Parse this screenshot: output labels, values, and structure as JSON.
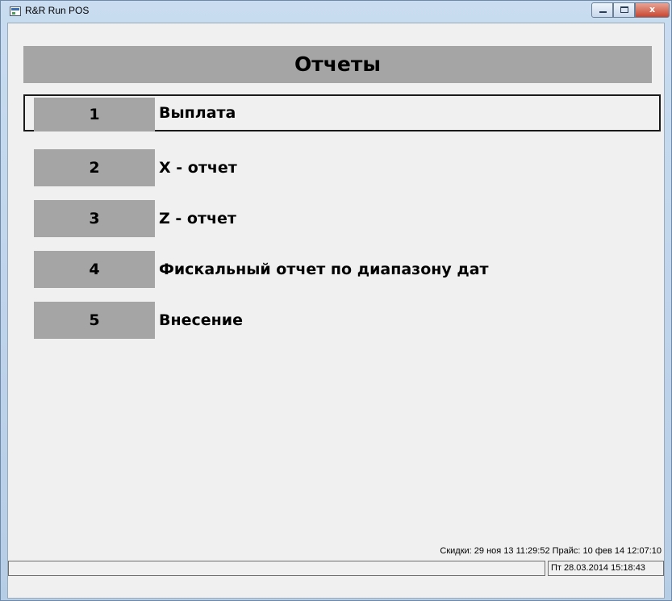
{
  "window": {
    "title": "R&R Run POS",
    "minimize_glyph": "",
    "maximize_glyph": "",
    "close_glyph": "x"
  },
  "header": {
    "title": "Отчеты"
  },
  "menu": {
    "items": [
      {
        "number": "1",
        "label": "Выплата",
        "selected": true
      },
      {
        "number": "2",
        "label": "X - отчет",
        "selected": false
      },
      {
        "number": "3",
        "label": "Z - отчет",
        "selected": false
      },
      {
        "number": "4",
        "label": "Фискальный отчет по диапазону дат",
        "selected": false
      },
      {
        "number": "5",
        "label": "Внесение",
        "selected": false
      }
    ]
  },
  "footer": {
    "info": "Скидки: 29 ноя 13 11:29:52 Прайс: 10 фев 14 12:07:10",
    "status_left": "",
    "datetime": "Пт 28.03.2014 15:18:43"
  },
  "colors": {
    "header_bg": "#a5a5a5",
    "client_bg": "#f0f0f0",
    "close_button": "#c8452f"
  }
}
